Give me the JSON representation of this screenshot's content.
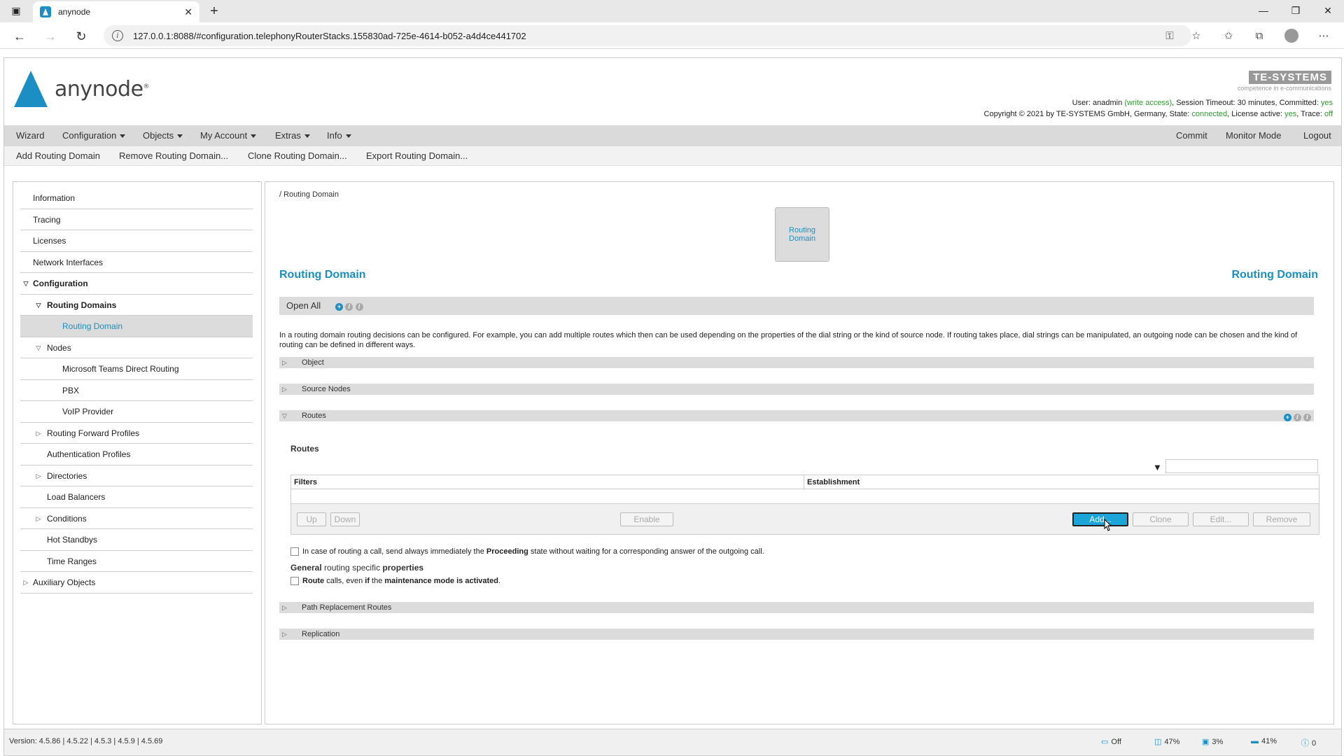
{
  "browser": {
    "tab_title": "anynode",
    "url": "127.0.0.1:8088/#configuration.telephonyRouterStacks.155830ad-725e-4614-b052-a4d4ce441702"
  },
  "app": {
    "logo_text": "anynode",
    "logo_reg": "®",
    "brand_name": "TE-SYSTEMS",
    "brand_sub": "competence in e-communications",
    "user_line": {
      "prefix": "User: anadmin ",
      "access": "(write access)",
      "mid": ", Session Timeout: 30 minutes, Committed: ",
      "committed": "yes"
    },
    "copyright_line": {
      "prefix": "Copyright © 2021 by TE-SYSTEMS GmbH, Germany, State: ",
      "state": "connected",
      "mid": ", License active: ",
      "license": "yes",
      "mid2": ", Trace: ",
      "trace": "off"
    }
  },
  "menu": {
    "left": [
      "Wizard",
      "Configuration",
      "Objects",
      "My Account",
      "Extras",
      "Info"
    ],
    "right": [
      "Commit",
      "Monitor Mode",
      "Logout"
    ]
  },
  "submenu": [
    "Add Routing Domain",
    "Remove Routing Domain...",
    "Clone Routing Domain...",
    "Export Routing Domain..."
  ],
  "sidebar": {
    "items": [
      {
        "label": "Information"
      },
      {
        "label": "Tracing"
      },
      {
        "label": "Licenses"
      },
      {
        "label": "Network Interfaces"
      },
      {
        "label": "Configuration"
      },
      {
        "label": "Routing Domains"
      },
      {
        "label": "Routing Domain"
      },
      {
        "label": "Nodes"
      },
      {
        "label": "Microsoft Teams Direct Routing"
      },
      {
        "label": "PBX"
      },
      {
        "label": "VoIP Provider"
      },
      {
        "label": "Routing Forward Profiles"
      },
      {
        "label": "Authentication Profiles"
      },
      {
        "label": "Directories"
      },
      {
        "label": "Load Balancers"
      },
      {
        "label": "Conditions"
      },
      {
        "label": "Hot Standbys"
      },
      {
        "label": "Time Ranges"
      },
      {
        "label": "Auxiliary Objects"
      }
    ]
  },
  "content": {
    "breadcrumb": "/ Routing Domain",
    "tile_label": "Routing Domain",
    "title": "Routing Domain",
    "title_right": "Routing Domain",
    "open_all": "Open All",
    "description": "In a routing domain routing decisions can be configured. For example, you can add multiple routes which then can be used depending on the properties of the dial string or the kind of source node. If routing takes place, dial strings can be manipulated, an outgoing node can be chosen and the kind of routing can be defined in different ways.",
    "sections": {
      "object": "Object",
      "source_nodes": "Source Nodes",
      "routes": "Routes",
      "path_replacement": "Path Replacement Routes",
      "replication": "Replication"
    },
    "routes_label": "Routes",
    "grid": {
      "columns": [
        "Filters",
        "Establishment"
      ],
      "buttons": {
        "up": "Up",
        "down": "Down",
        "enable": "Enable",
        "add": "Add...",
        "clone": "Clone",
        "edit": "Edit...",
        "remove": "Remove"
      }
    },
    "proceeding_check": {
      "pre": "In case of routing a call, send always immediately the ",
      "bold": "Proceeding",
      "post": " state without waiting for a corresponding answer of the outgoing call."
    },
    "general_header": {
      "b1": "General",
      "t1": " routing specific ",
      "b2": "properties"
    },
    "maintenance_check": {
      "b1": "Route",
      "t1": " calls, even ",
      "b2": "if",
      "t2": " the ",
      "b3": "maintenance mode is activated",
      "t3": "."
    }
  },
  "statusbar": {
    "version": "Version: 4.5.86 | 4.5.22 | 4.5.3 | 4.5.9 | 4.5.69",
    "items": [
      "Off",
      "47%",
      "3%",
      "41%",
      "0"
    ]
  },
  "colors": {
    "accent": "#1b8fc4",
    "menu_bg": "#dadada",
    "status_green": "#2aa02a"
  }
}
